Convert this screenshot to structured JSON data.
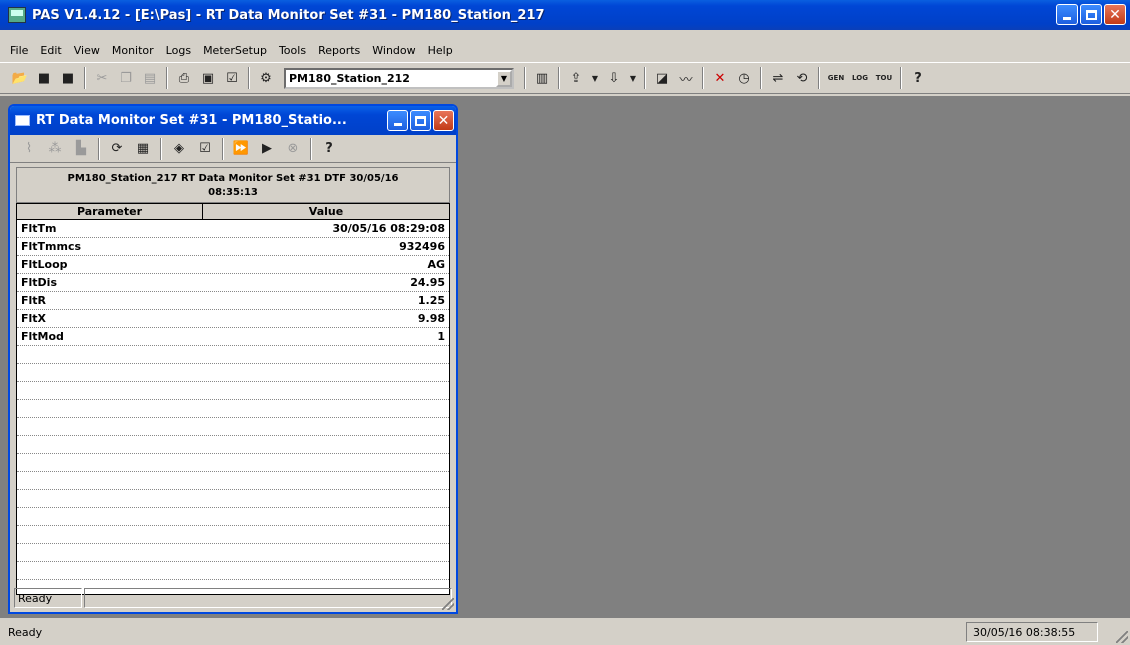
{
  "app": {
    "title": "PAS V1.4.12 - [E:\\Pas] - RT Data Monitor Set #31 - PM180_Station_217"
  },
  "menu": [
    "File",
    "Edit",
    "View",
    "Monitor",
    "Logs",
    "MeterSetup",
    "Tools",
    "Reports",
    "Window",
    "Help"
  ],
  "toolbar": {
    "site_combo_value": "PM180_Station_212"
  },
  "child": {
    "title": "RT Data Monitor Set #31 - PM180_Statio...",
    "header_line1": "PM180_Station_217  RT Data Monitor  Set #31  DTF  30/05/16",
    "header_line2": "08:35:13",
    "col_param": "Parameter",
    "col_value": "Value",
    "rows": [
      {
        "param": "FltTm",
        "value": "30/05/16 08:29:08"
      },
      {
        "param": "FltTmmcs",
        "value": "932496"
      },
      {
        "param": "FltLoop",
        "value": "AG"
      },
      {
        "param": "FltDis",
        "value": "24.95"
      },
      {
        "param": "FltR",
        "value": "1.25"
      },
      {
        "param": "FltX",
        "value": "9.98"
      },
      {
        "param": "FltMod",
        "value": "1"
      }
    ],
    "status": "Ready"
  },
  "status": {
    "left": "Ready",
    "time": "30/05/16 08:38:55"
  }
}
